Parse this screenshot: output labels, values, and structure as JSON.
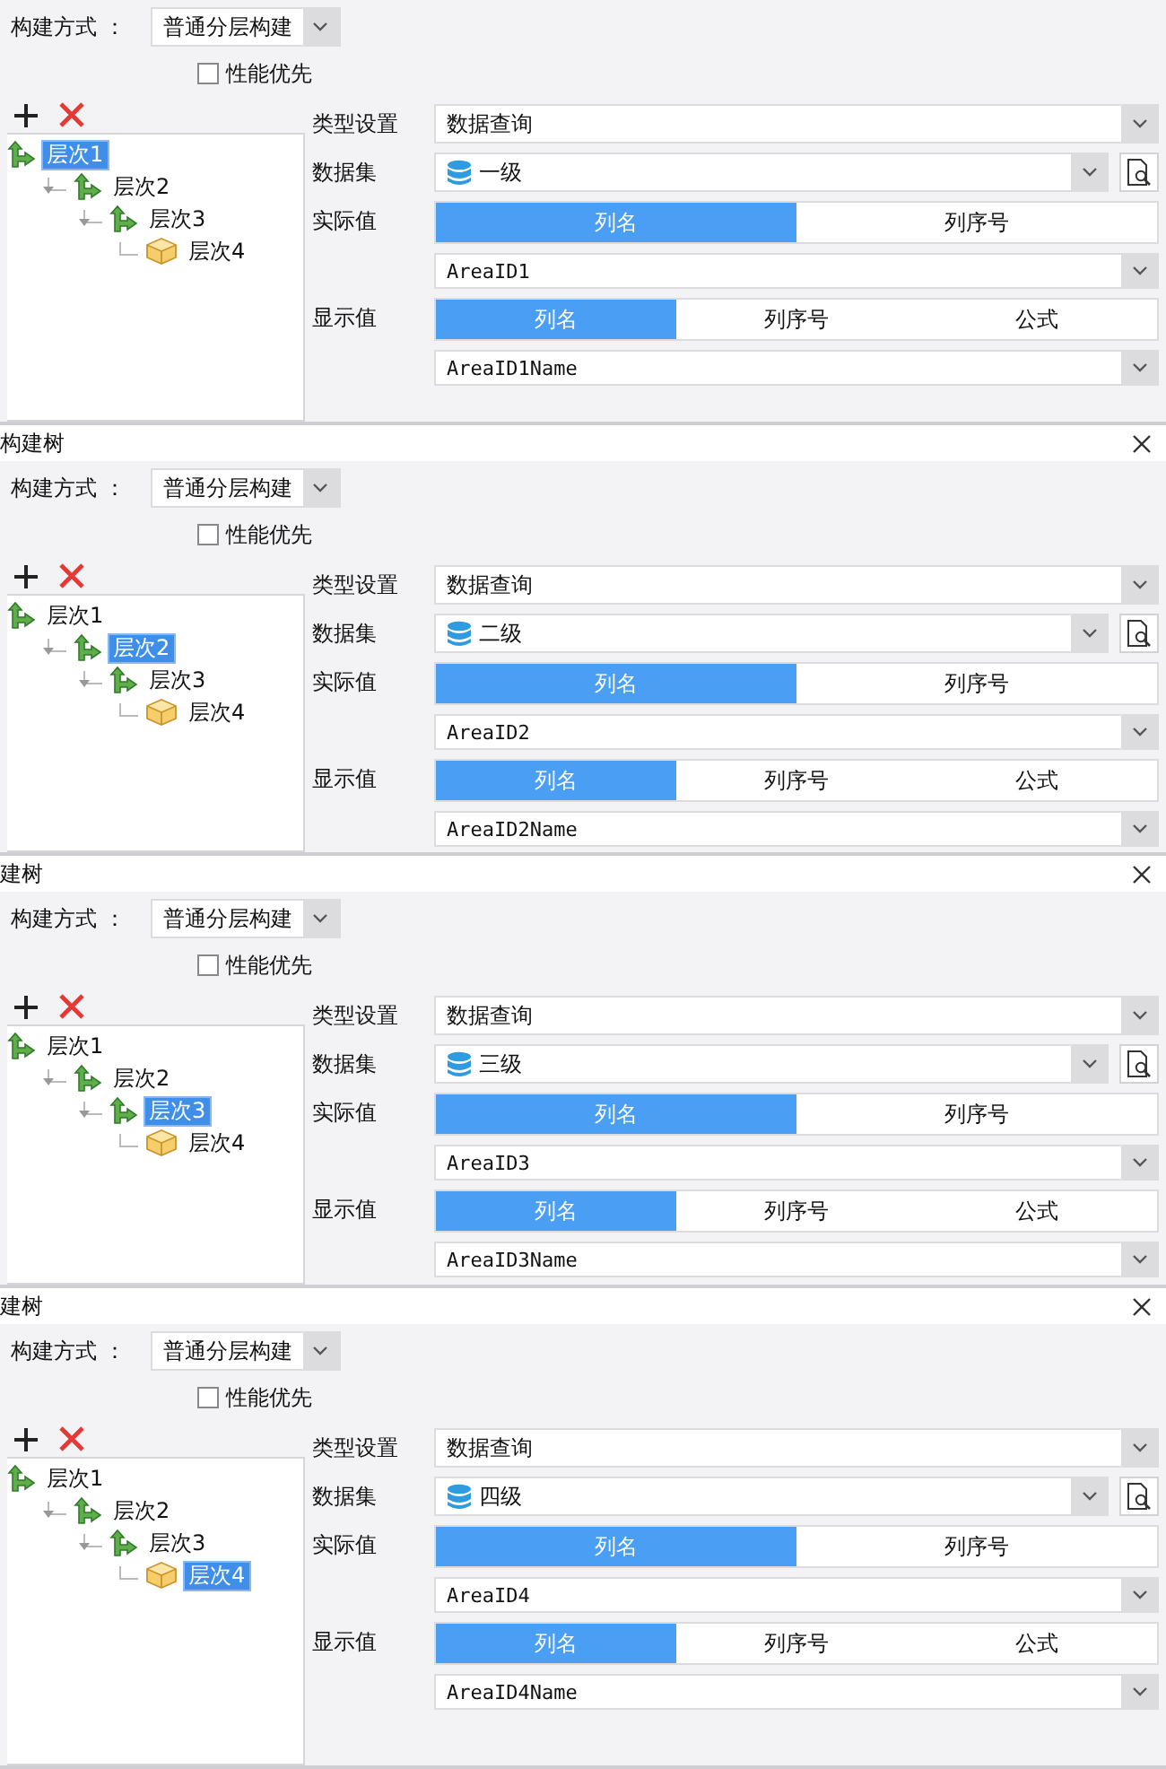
{
  "panels": [
    {
      "build_mode": {
        "label": "构建方式 ：",
        "value": "普通分层构建"
      },
      "performance_first": {
        "label": "性能优先",
        "checked": false
      },
      "tree": [
        {
          "label": "层次1",
          "kind": "branch",
          "selected": true,
          "children": [
            {
              "label": "层次2",
              "kind": "branch",
              "selected": false,
              "children": [
                {
                  "label": "层次3",
                  "kind": "branch",
                  "selected": false,
                  "children": [
                    {
                      "label": "层次4",
                      "kind": "leaf",
                      "selected": false
                    }
                  ]
                }
              ]
            }
          ]
        }
      ],
      "type_setting": {
        "label": "类型设置",
        "value": "数据查询"
      },
      "dataset": {
        "label": "数据集",
        "value": "一级"
      },
      "actual_value": {
        "label": "实际值",
        "tabs": [
          {
            "label": "列名",
            "selected": true
          },
          {
            "label": "列序号",
            "selected": false
          }
        ],
        "column": "AreaID1"
      },
      "display_value": {
        "label": "显示值",
        "tabs": [
          {
            "label": "列名",
            "selected": true
          },
          {
            "label": "列序号",
            "selected": false
          },
          {
            "label": "公式",
            "selected": false
          }
        ],
        "column": "AreaID1Name"
      }
    },
    {
      "title": "构建树",
      "build_mode": {
        "label": "构建方式 ：",
        "value": "普通分层构建"
      },
      "performance_first": {
        "label": "性能优先",
        "checked": false
      },
      "tree": [
        {
          "label": "层次1",
          "kind": "branch",
          "selected": false,
          "children": [
            {
              "label": "层次2",
              "kind": "branch",
              "selected": true,
              "children": [
                {
                  "label": "层次3",
                  "kind": "branch",
                  "selected": false,
                  "children": [
                    {
                      "label": "层次4",
                      "kind": "leaf",
                      "selected": false
                    }
                  ]
                }
              ]
            }
          ]
        }
      ],
      "type_setting": {
        "label": "类型设置",
        "value": "数据查询"
      },
      "dataset": {
        "label": "数据集",
        "value": "二级"
      },
      "actual_value": {
        "label": "实际值",
        "tabs": [
          {
            "label": "列名",
            "selected": true
          },
          {
            "label": "列序号",
            "selected": false
          }
        ],
        "column": "AreaID2"
      },
      "display_value": {
        "label": "显示值",
        "tabs": [
          {
            "label": "列名",
            "selected": true
          },
          {
            "label": "列序号",
            "selected": false
          },
          {
            "label": "公式",
            "selected": false
          }
        ],
        "column": "AreaID2Name"
      }
    },
    {
      "title": "建树",
      "build_mode": {
        "label": "构建方式 ：",
        "value": "普通分层构建"
      },
      "performance_first": {
        "label": "性能优先",
        "checked": false
      },
      "tree": [
        {
          "label": "层次1",
          "kind": "branch",
          "selected": false,
          "children": [
            {
              "label": "层次2",
              "kind": "branch",
              "selected": false,
              "children": [
                {
                  "label": "层次3",
                  "kind": "branch",
                  "selected": true,
                  "children": [
                    {
                      "label": "层次4",
                      "kind": "leaf",
                      "selected": false
                    }
                  ]
                }
              ]
            }
          ]
        }
      ],
      "type_setting": {
        "label": "类型设置",
        "value": "数据查询"
      },
      "dataset": {
        "label": "数据集",
        "value": "三级"
      },
      "actual_value": {
        "label": "实际值",
        "tabs": [
          {
            "label": "列名",
            "selected": true
          },
          {
            "label": "列序号",
            "selected": false
          }
        ],
        "column": "AreaID3"
      },
      "display_value": {
        "label": "显示值",
        "tabs": [
          {
            "label": "列名",
            "selected": true
          },
          {
            "label": "列序号",
            "selected": false
          },
          {
            "label": "公式",
            "selected": false
          }
        ],
        "column": "AreaID3Name"
      }
    },
    {
      "title": "建树",
      "build_mode": {
        "label": "构建方式 ：",
        "value": "普通分层构建"
      },
      "performance_first": {
        "label": "性能优先",
        "checked": false
      },
      "tree": [
        {
          "label": "层次1",
          "kind": "branch",
          "selected": false,
          "children": [
            {
              "label": "层次2",
              "kind": "branch",
              "selected": false,
              "children": [
                {
                  "label": "层次3",
                  "kind": "branch",
                  "selected": false,
                  "children": [
                    {
                      "label": "层次4",
                      "kind": "leaf",
                      "selected": true
                    }
                  ]
                }
              ]
            }
          ]
        }
      ],
      "type_setting": {
        "label": "类型设置",
        "value": "数据查询"
      },
      "dataset": {
        "label": "数据集",
        "value": "四级"
      },
      "actual_value": {
        "label": "实际值",
        "tabs": [
          {
            "label": "列名",
            "selected": true
          },
          {
            "label": "列序号",
            "selected": false
          }
        ],
        "column": "AreaID4"
      },
      "display_value": {
        "label": "显示值",
        "tabs": [
          {
            "label": "列名",
            "selected": true
          },
          {
            "label": "列序号",
            "selected": false
          },
          {
            "label": "公式",
            "selected": false
          }
        ],
        "column": "AreaID4Name"
      }
    }
  ]
}
